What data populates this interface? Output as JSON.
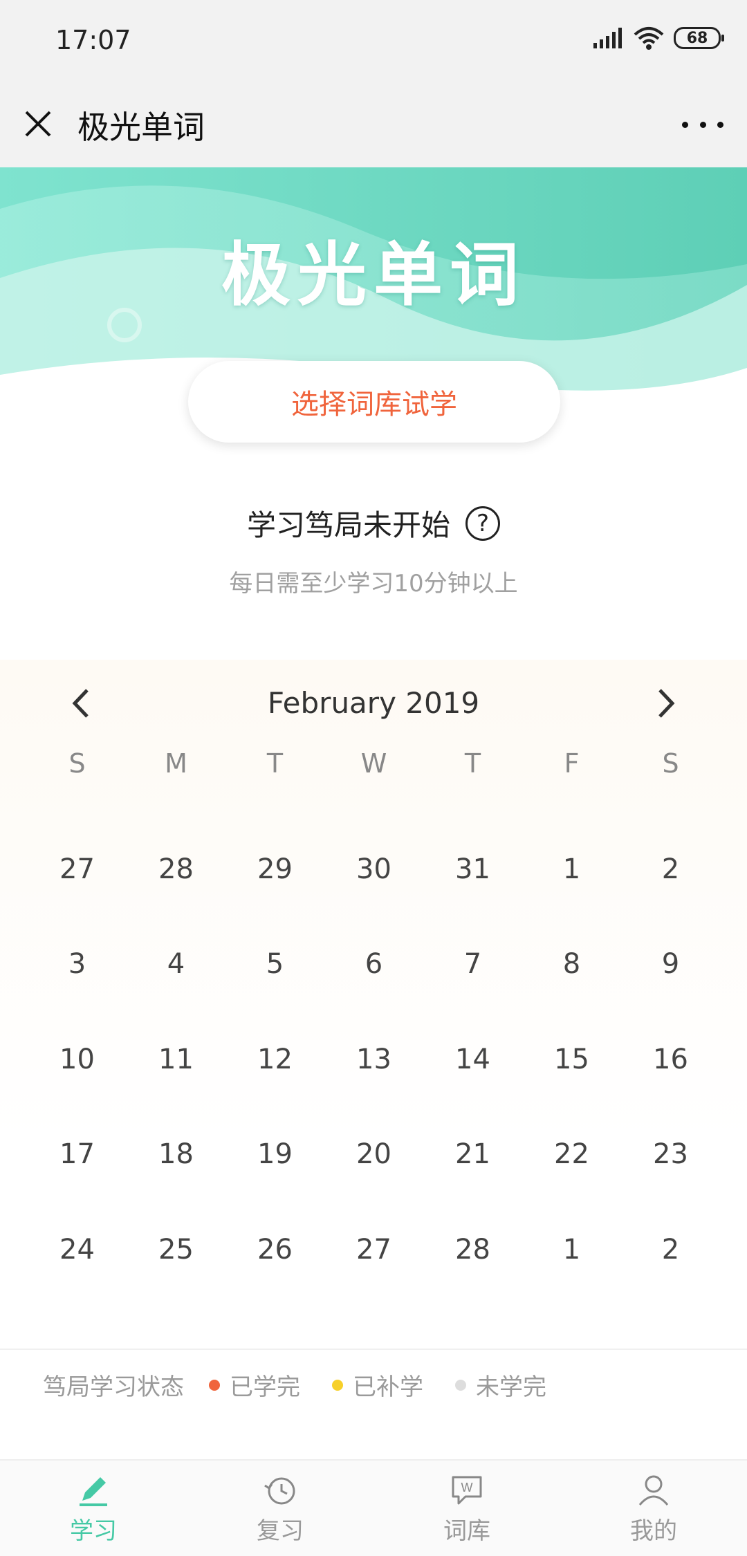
{
  "status": {
    "time": "17:07",
    "battery": "68"
  },
  "titlebar": {
    "title": "极光单词"
  },
  "hero": {
    "title": "极光单词",
    "trial_button": "选择词库试学"
  },
  "streak": {
    "title": "学习笃局未开始",
    "subtitle": "每日需至少学习10分钟以上"
  },
  "calendar": {
    "month": "February 2019",
    "weekdays": [
      "S",
      "M",
      "T",
      "W",
      "T",
      "F",
      "S"
    ],
    "days": [
      "27",
      "28",
      "29",
      "30",
      "31",
      "1",
      "2",
      "3",
      "4",
      "5",
      "6",
      "7",
      "8",
      "9",
      "10",
      "11",
      "12",
      "13",
      "14",
      "15",
      "16",
      "17",
      "18",
      "19",
      "20",
      "21",
      "22",
      "23",
      "24",
      "25",
      "26",
      "27",
      "28",
      "1",
      "2"
    ]
  },
  "legend": {
    "label": "笃局学习状态",
    "items": [
      {
        "label": "已学完",
        "color": "#f0643c"
      },
      {
        "label": "已补学",
        "color": "#f7d02a"
      },
      {
        "label": "未学完",
        "color": "#dddddd"
      }
    ]
  },
  "nav": {
    "items": [
      {
        "label": "学习",
        "icon": "pencil-icon"
      },
      {
        "label": "复习",
        "icon": "history-icon"
      },
      {
        "label": "词库",
        "icon": "word-bubble-icon"
      },
      {
        "label": "我的",
        "icon": "user-icon"
      }
    ]
  },
  "colors": {
    "accent": "#45c9a5",
    "orange": "#f0643c",
    "hero_teal": "#6dd9c2"
  }
}
